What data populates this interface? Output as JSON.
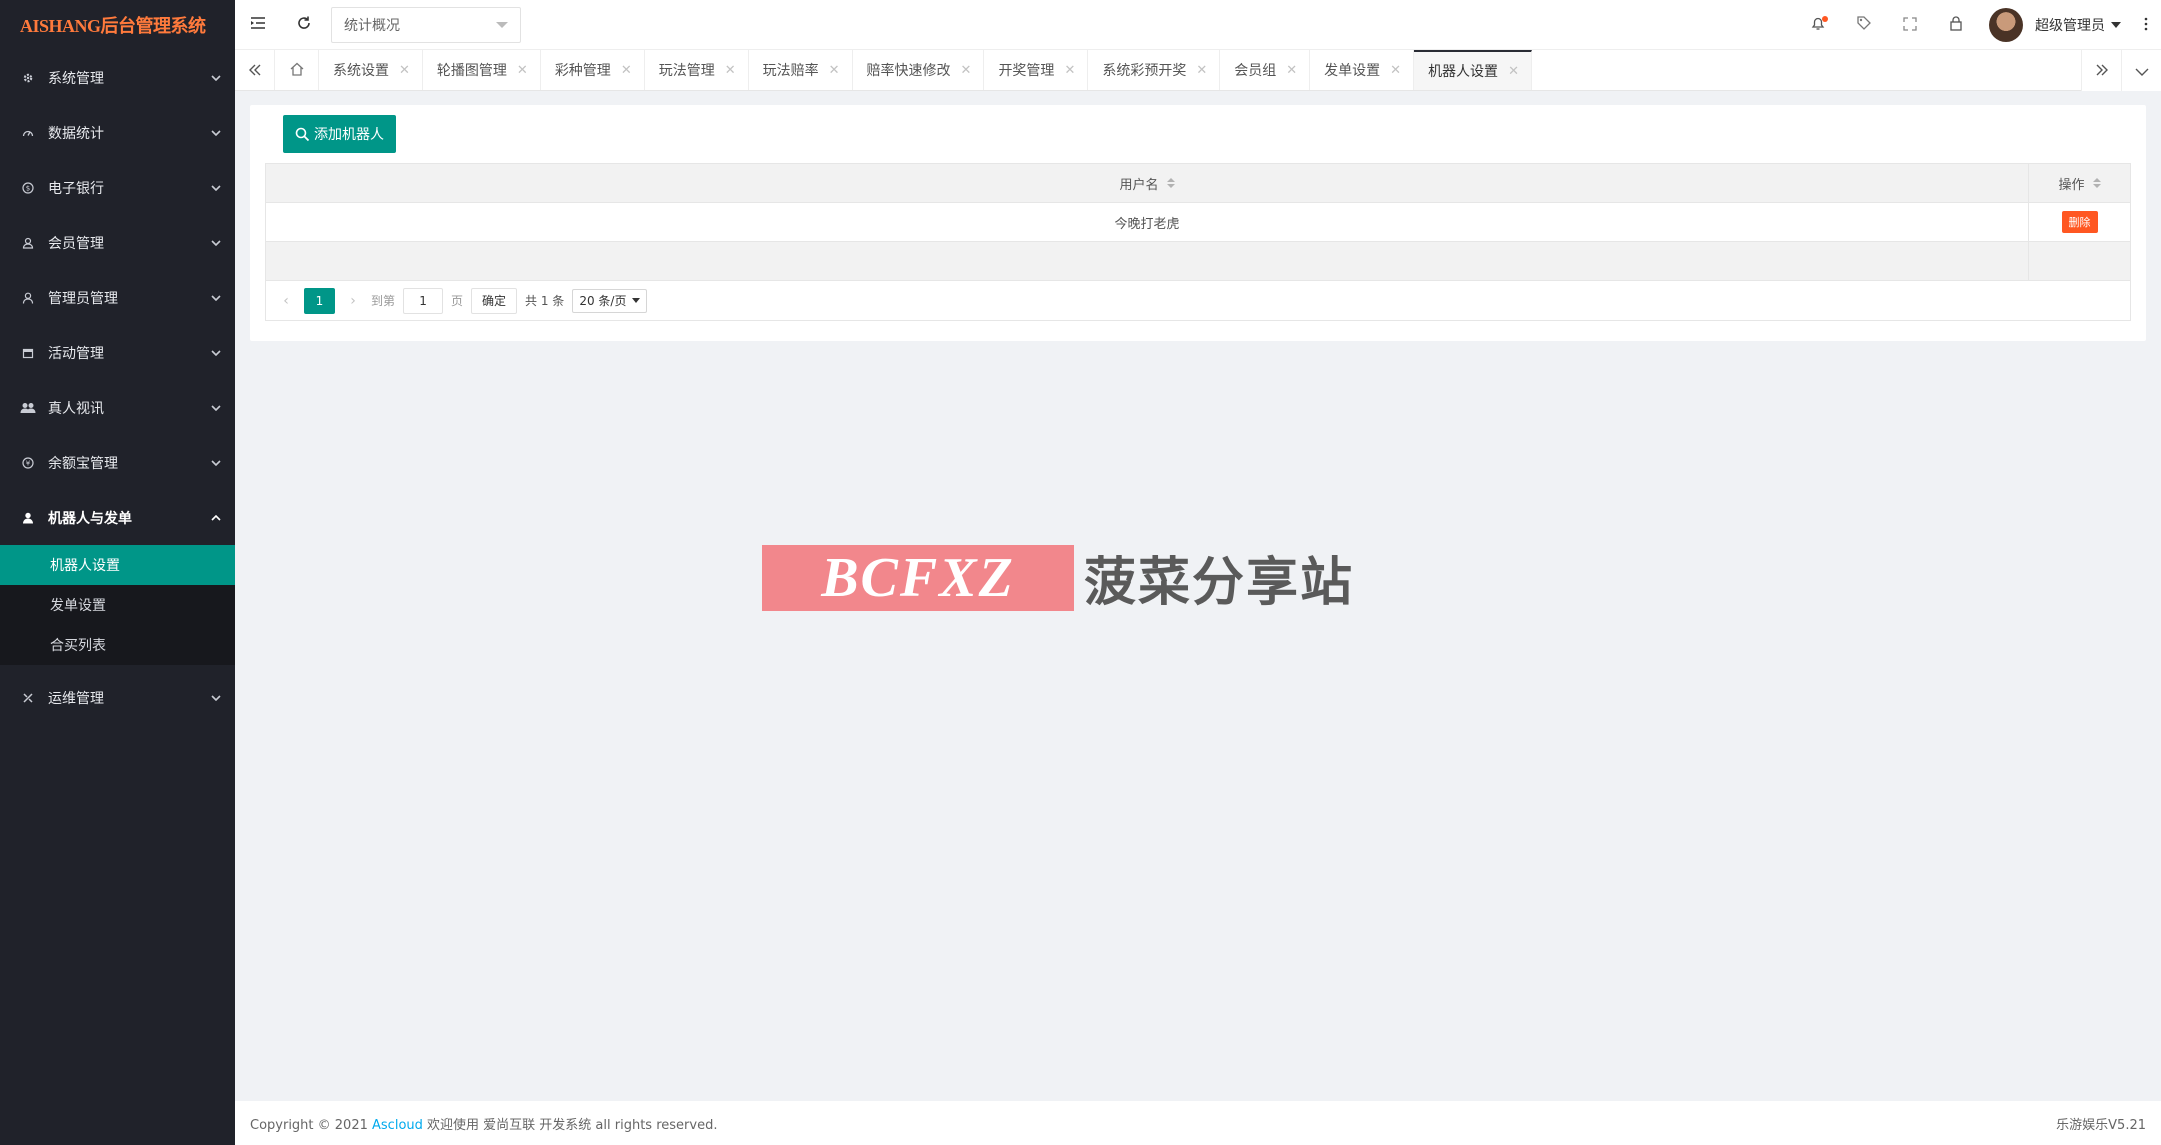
{
  "app": {
    "logo_text": "AISHANG后台管理系统"
  },
  "header": {
    "select_value": "统计概况",
    "user_name": "超级管理员"
  },
  "sidebar": {
    "items": [
      {
        "label": "系统管理",
        "icon": "gear-icon"
      },
      {
        "label": "数据统计",
        "icon": "dashboard-icon"
      },
      {
        "label": "电子银行",
        "icon": "dollar-icon"
      },
      {
        "label": "会员管理",
        "icon": "user-icon"
      },
      {
        "label": "管理员管理",
        "icon": "admin-icon"
      },
      {
        "label": "活动管理",
        "icon": "calendar-icon"
      },
      {
        "label": "真人视讯",
        "icon": "users-icon"
      },
      {
        "label": "余额宝管理",
        "icon": "yen-icon"
      },
      {
        "label": "机器人与发单",
        "icon": "person-icon"
      },
      {
        "label": "运维管理",
        "icon": "tools-icon"
      }
    ],
    "submenu": [
      {
        "label": "机器人设置",
        "active": true
      },
      {
        "label": "发单设置"
      },
      {
        "label": "合买列表"
      }
    ]
  },
  "tabs": [
    {
      "label": "系统设置"
    },
    {
      "label": "轮播图管理"
    },
    {
      "label": "彩种管理"
    },
    {
      "label": "玩法管理"
    },
    {
      "label": "玩法赔率"
    },
    {
      "label": "赔率快速修改"
    },
    {
      "label": "开奖管理"
    },
    {
      "label": "系统彩预开奖"
    },
    {
      "label": "会员组"
    },
    {
      "label": "发单设置"
    },
    {
      "label": "机器人设置",
      "active": true
    }
  ],
  "content": {
    "add_button": "添加机器人",
    "table": {
      "headers": {
        "username": "用户名",
        "action": "操作"
      },
      "rows": [
        {
          "username": "今晚打老虎",
          "action": "删除"
        }
      ]
    },
    "pager": {
      "current_page": "1",
      "goto_label": "到第",
      "goto_value": "1",
      "page_label": "页",
      "confirm": "确定",
      "total": "共 1 条",
      "page_size": "20 条/页"
    }
  },
  "watermark": {
    "box_text": "BCFXZ",
    "text": "菠菜分享站"
  },
  "footer": {
    "copyright_prefix": "Copyright © 2021",
    "link": "Ascloud",
    "copyright_suffix": "欢迎使用 爱尚互联 开发系统 all rights reserved.",
    "version": "乐游娱乐V5.21"
  },
  "colors": {
    "sidebar_bg": "#20222a",
    "accent": "#009688",
    "danger": "#ff5722",
    "logo": "#ff7a3c"
  }
}
